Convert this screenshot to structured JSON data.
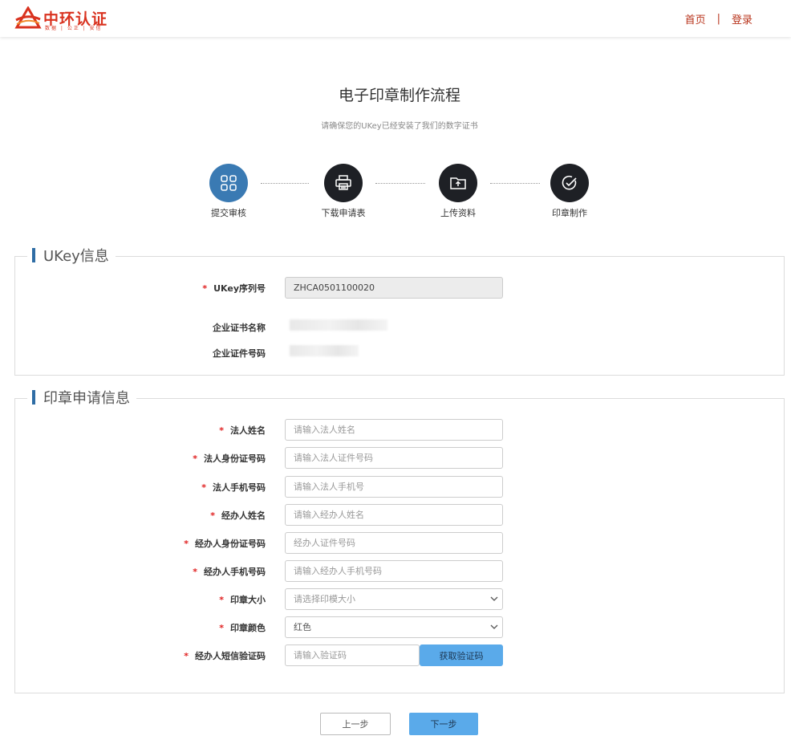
{
  "header": {
    "logo_text": "中环认证",
    "logo_sub": "数据 | 公正 | 安信",
    "nav_home": "首页",
    "nav_sep": "|",
    "nav_login": "登录"
  },
  "page": {
    "title": "电子印章制作流程",
    "subtitle": "请确保您的UKey已经安装了我们的数字证书"
  },
  "steps": [
    {
      "label": "提交审核",
      "icon": "grid-icon",
      "active": true
    },
    {
      "label": "下载申请表",
      "icon": "printer-icon",
      "active": false
    },
    {
      "label": "上传资料",
      "icon": "folder-upload-icon",
      "active": false
    },
    {
      "label": "印章制作",
      "icon": "check-circle-icon",
      "active": false
    }
  ],
  "ukey_section": {
    "title": "UKey信息",
    "serial_label": "UKey序列号",
    "serial_value": "ZHCA0501100020",
    "cert_name_label": "企业证书名称",
    "cert_no_label": "企业证件号码"
  },
  "seal_section": {
    "title": "印章申请信息",
    "fields": {
      "legal_name": {
        "label": "法人姓名",
        "placeholder": "请输入法人姓名"
      },
      "legal_id": {
        "label": "法人身份证号码",
        "placeholder": "请输入法人证件号码"
      },
      "legal_phone": {
        "label": "法人手机号码",
        "placeholder": "请输入法人手机号"
      },
      "agent_name": {
        "label": "经办人姓名",
        "placeholder": "请输入经办人姓名"
      },
      "agent_id": {
        "label": "经办人身份证号码",
        "placeholder": "经办人证件号码"
      },
      "agent_phone": {
        "label": "经办人手机号码",
        "placeholder": "请输入经办人手机号码"
      },
      "seal_size": {
        "label": "印章大小",
        "selected": "请选择印模大小"
      },
      "seal_color": {
        "label": "印章颜色",
        "selected": "红色"
      },
      "sms_code": {
        "label": "经办人短信验证码",
        "placeholder": "请输入验证码",
        "button": "获取验证码"
      }
    },
    "required_mark": "*"
  },
  "footer": {
    "prev_label": "上一步",
    "next_label": "下一步"
  },
  "colors": {
    "brand": "#d9321f",
    "nav": "#b8341c",
    "step_active": "#3a7ab3",
    "step_inactive": "#1e2025",
    "primary_button": "#5aaaea",
    "required": "#e02020",
    "legend_bar": "#2f6da5"
  }
}
